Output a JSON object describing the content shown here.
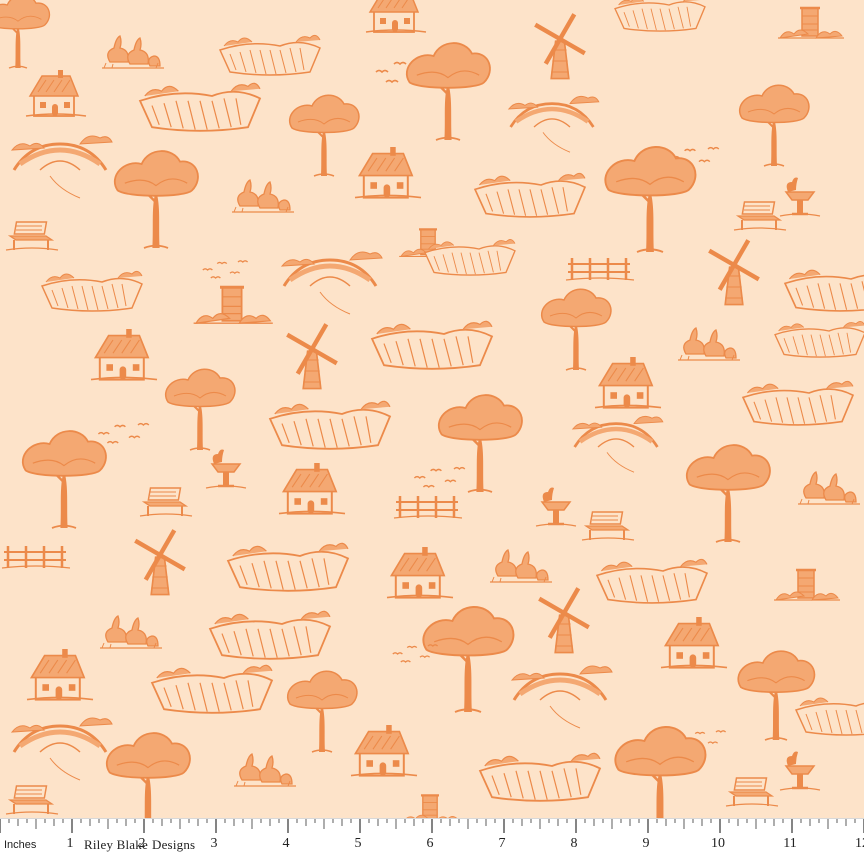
{
  "image": {
    "description_kind": "fabric swatch with repeating toile print",
    "colors": {
      "background": "#fde3c9",
      "ink": "#ec8a4a",
      "ink_light": "#f4a872",
      "ruler_bg": "#ffffff",
      "ruler_text": "#222222"
    }
  },
  "pattern": {
    "motif_icons": [
      "tree-icon",
      "cottage-icon",
      "windmill-icon",
      "field-icon",
      "geese-icon",
      "bench-icon",
      "birdbath-icon",
      "bridge-icon",
      "fence-icon",
      "birds-icon",
      "beehive-icon"
    ]
  },
  "ruler": {
    "unit_label": "Inches",
    "brand_part1": "Riley Blake",
    "brand_part2": "Designs",
    "numbers": [
      "1",
      "2",
      "3",
      "4",
      "5",
      "6",
      "7",
      "8",
      "9",
      "10",
      "11",
      "12"
    ]
  }
}
